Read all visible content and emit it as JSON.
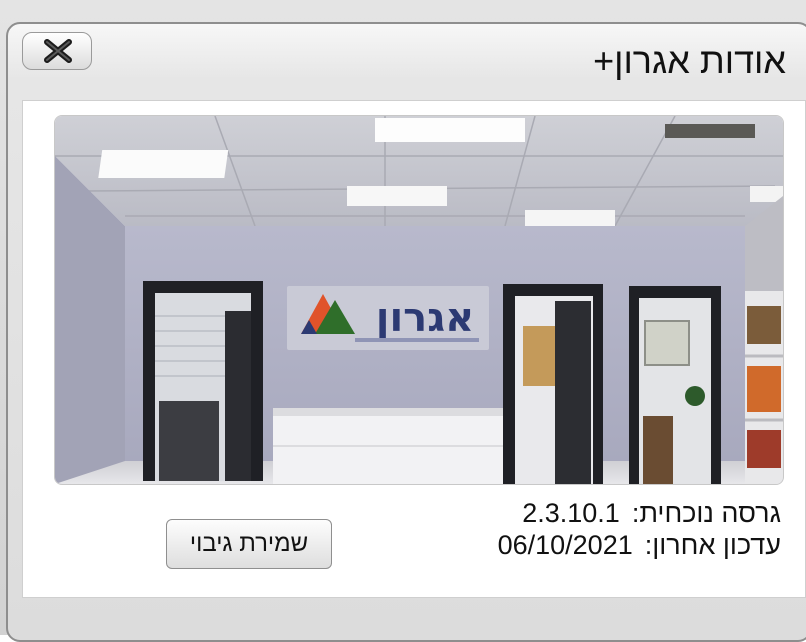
{
  "window": {
    "title": "אודות אגרון+",
    "close_icon": "close-icon"
  },
  "photo": {
    "sign_text": "אגרון",
    "icon": "office-reception-photo"
  },
  "info": {
    "version_label": "גרסה נוכחית:",
    "version_value": "2.3.10.1",
    "updated_label": "עדכון אחרון:",
    "updated_value": "06/10/2021"
  },
  "actions": {
    "backup_label": "שמירת גיבוי"
  },
  "colors": {
    "logo_orange": "#e0532a",
    "logo_green": "#2f6e2a",
    "logo_navy": "#2c3a73"
  }
}
